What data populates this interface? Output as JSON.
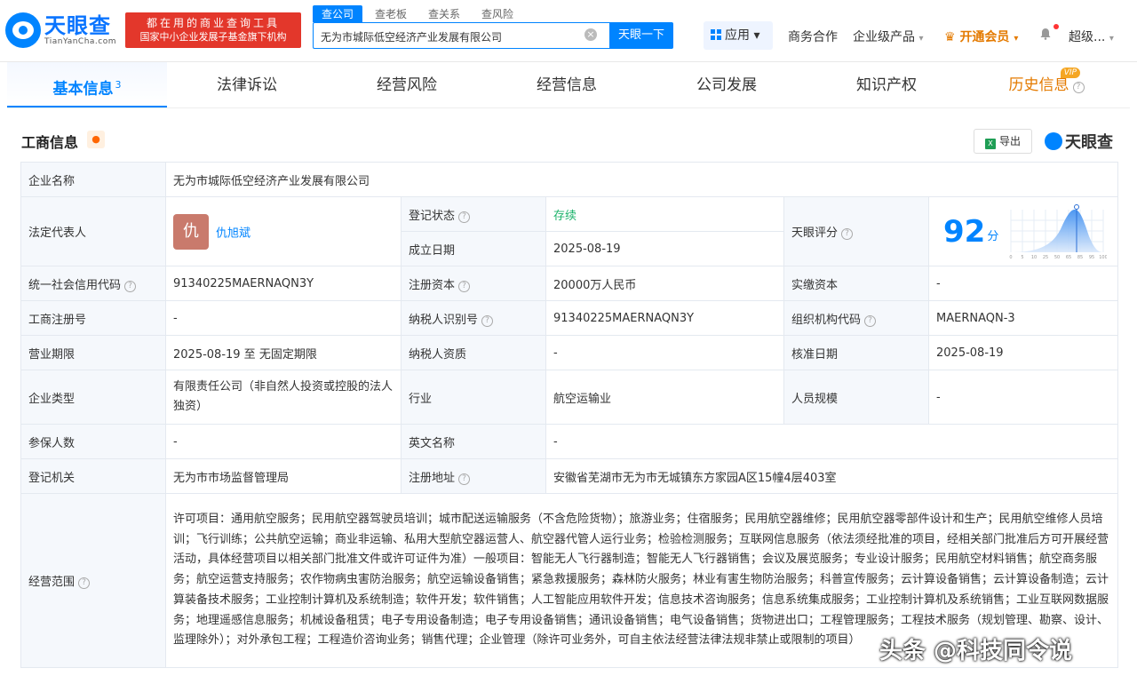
{
  "header": {
    "logo_cn": "天眼查",
    "logo_en": "TianYanCha.com",
    "slogan_line1": "都在用的商业查询工具",
    "slogan_line2": "国家中小企业发展子基金旗下机构",
    "search_tabs": [
      "查公司",
      "查老板",
      "查关系",
      "查风险"
    ],
    "search_value": "无为市城际低空经济产业发展有限公司",
    "search_button": "天眼一下",
    "app_label": "应用",
    "nav": [
      "商务合作",
      "企业级产品",
      "开通会员",
      "超级..."
    ]
  },
  "tabs": [
    {
      "label": "基本信息",
      "count": "3"
    },
    {
      "label": "法律诉讼"
    },
    {
      "label": "经营风险"
    },
    {
      "label": "经营信息"
    },
    {
      "label": "公司发展"
    },
    {
      "label": "知识产权"
    },
    {
      "label": "历史信息",
      "badge": "VIP"
    }
  ],
  "section": {
    "title": "工商信息",
    "export_label": "导出",
    "brand": "天眼查"
  },
  "info": {
    "company_name_label": "企业名称",
    "company_name": "无为市城际低空经济产业发展有限公司",
    "legal_rep_label": "法定代表人",
    "legal_rep_avatar": "仇",
    "legal_rep": "仇旭斌",
    "reg_status_label": "登记状态",
    "reg_status": "存续",
    "found_date_label": "成立日期",
    "found_date": "2025-08-19",
    "score_label": "天眼评分",
    "score": "92",
    "score_unit": "分",
    "score_ticks": [
      "0",
      "5",
      "10",
      "25",
      "50",
      "65",
      "85",
      "95",
      "100"
    ],
    "credit_code_label": "统一社会信用代码",
    "credit_code": "91340225MAERNAQN3Y",
    "reg_capital_label": "注册资本",
    "reg_capital": "20000万人民币",
    "paid_capital_label": "实缴资本",
    "paid_capital": "-",
    "biz_reg_no_label": "工商注册号",
    "biz_reg_no": "-",
    "taxpayer_id_label": "纳税人识别号",
    "taxpayer_id": "91340225MAERNAQN3Y",
    "org_code_label": "组织机构代码",
    "org_code": "MAERNAQN-3",
    "biz_term_label": "营业期限",
    "biz_term": "2025-08-19 至 无固定期限",
    "taxpayer_qual_label": "纳税人资质",
    "taxpayer_qual": "-",
    "approve_date_label": "核准日期",
    "approve_date": "2025-08-19",
    "company_type_label": "企业类型",
    "company_type": "有限责任公司（非自然人投资或控股的法人独资）",
    "industry_label": "行业",
    "industry": "航空运输业",
    "staff_size_label": "人员规模",
    "staff_size": "-",
    "insured_label": "参保人数",
    "insured": "-",
    "en_name_label": "英文名称",
    "en_name": "-",
    "reg_authority_label": "登记机关",
    "reg_authority": "无为市市场监督管理局",
    "reg_address_label": "注册地址",
    "reg_address": "安徽省芜湖市无为市无城镇东方家园A区15幢4层403室",
    "scope_label": "经营范围",
    "scope": "许可项目：通用航空服务；民用航空器驾驶员培训；城市配送运输服务（不含危险货物）；旅游业务；住宿服务；民用航空器维修；民用航空器零部件设计和生产；民用航空维修人员培训；飞行训练；公共航空运输；商业非运输、私用大型航空器运营人、航空器代管人运行业务；检验检测服务；互联网信息服务（依法须经批准的项目，经相关部门批准后方可开展经营活动，具体经营项目以相关部门批准文件或许可证件为准）一般项目：智能无人飞行器制造；智能无人飞行器销售；会议及展览服务；专业设计服务；民用航空材料销售；航空商务服务；航空运营支持服务；农作物病虫害防治服务；航空运输设备销售；紧急救援服务；森林防火服务；林业有害生物防治服务；科普宣传服务；云计算设备销售；云计算设备制造；云计算装备技术服务；工业控制计算机及系统制造；软件开发；软件销售；人工智能应用软件开发；信息技术咨询服务；信息系统集成服务；工业控制计算机及系统销售；工业互联网数据服务；地理遥感信息服务；机械设备租赁；电子专用设备制造；电子专用设备销售；通讯设备销售；电气设备销售；货物进出口；工程管理服务；工程技术服务（规划管理、勘察、设计、监理除外）；对外承包工程；工程造价咨询业务；销售代理；企业管理（除许可业务外，可自主依法经营法律法规非禁止或限制的项目）"
  },
  "watermark": "头条 @科技同令说"
}
